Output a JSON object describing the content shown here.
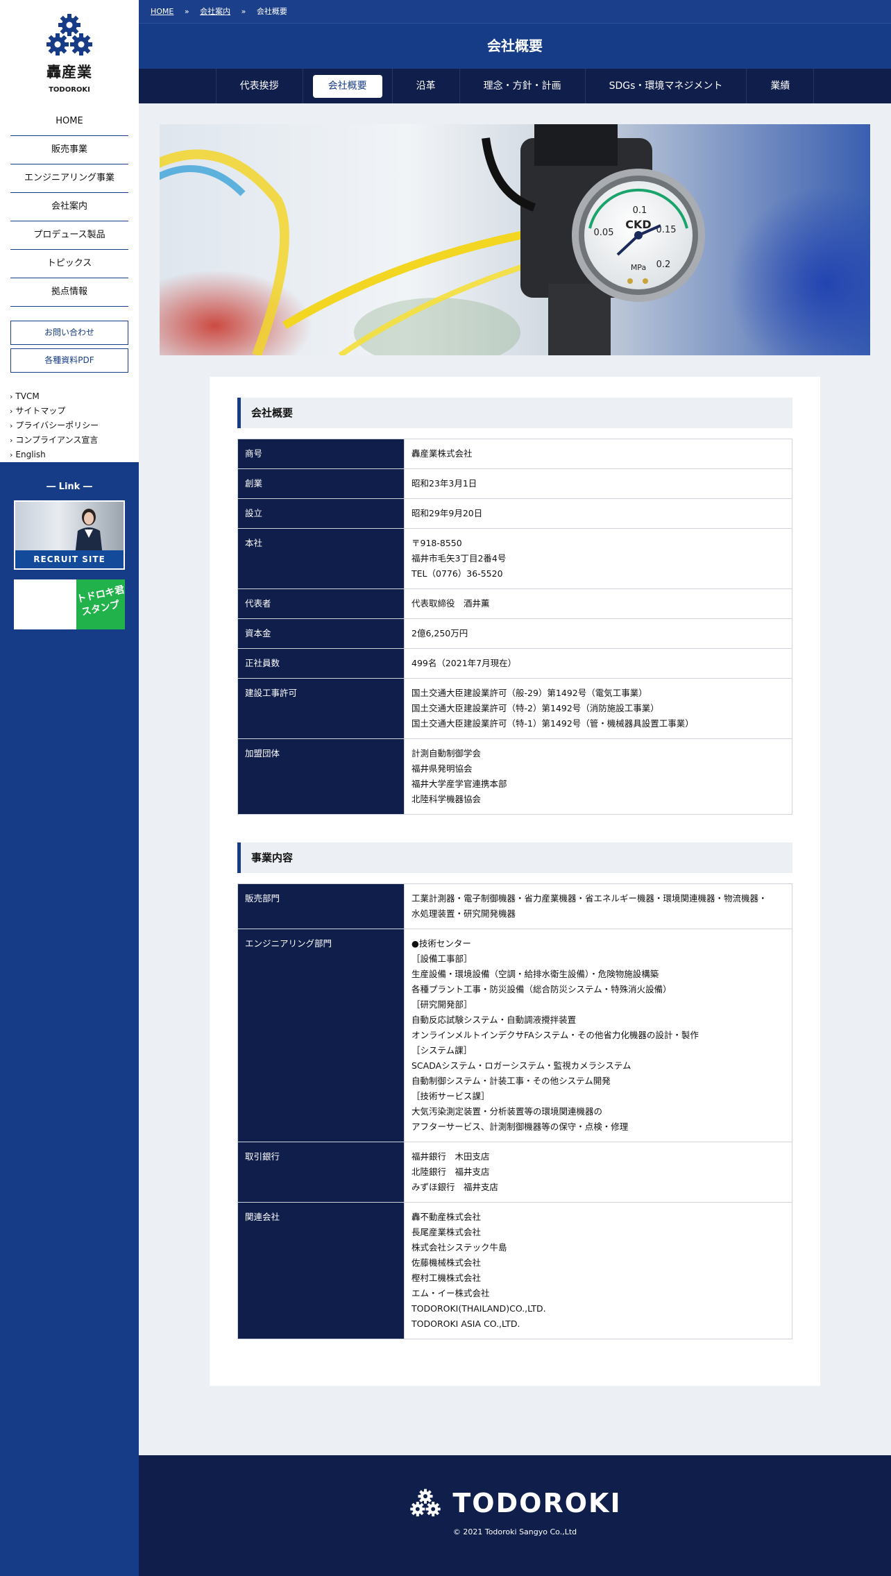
{
  "brand": {
    "name_jp": "轟産業",
    "name_en": "TODOROKI",
    "accent": "#163c87",
    "dark": "#101e4b"
  },
  "sidebar": {
    "nav": [
      {
        "label": "HOME"
      },
      {
        "label": "販売事業"
      },
      {
        "label": "エンジニアリング事業"
      },
      {
        "label": "会社案内"
      },
      {
        "label": "プロデュース製品"
      },
      {
        "label": "トピックス"
      },
      {
        "label": "拠点情報"
      }
    ],
    "buttons": [
      {
        "label": "お問い合わせ"
      },
      {
        "label": "各種資料PDF"
      }
    ],
    "sub_links": [
      {
        "label": "TVCM"
      },
      {
        "label": "サイトマップ"
      },
      {
        "label": "プライバシーポリシー"
      },
      {
        "label": "コンプライアンス宣言"
      },
      {
        "label": "English"
      }
    ],
    "link_title": "― Link ―",
    "recruit_label": "RECRUIT SITE",
    "stamp_line1": "トドロキ君",
    "stamp_line2": "スタンプ"
  },
  "breadcrumb": {
    "home": "HOME",
    "parent": "会社案内",
    "current": "会社概要",
    "sep": "»"
  },
  "page_title": "会社概要",
  "tabs": [
    {
      "label": "代表挨拶"
    },
    {
      "label": "会社概要"
    },
    {
      "label": "沿革"
    },
    {
      "label": "理念・方針・計画"
    },
    {
      "label": "SDGs・環境マネジメント"
    },
    {
      "label": "業績"
    }
  ],
  "hero": {
    "gauge_brand": "CKD",
    "gauge_unit": "MPa",
    "gauge_marks": [
      "0.05",
      "0.1",
      "0.15",
      "0.2"
    ]
  },
  "company": {
    "heading": "会社概要",
    "rows": [
      {
        "label": "商号",
        "lines": [
          "轟産業株式会社"
        ]
      },
      {
        "label": "創業",
        "lines": [
          "昭和23年3月1日"
        ]
      },
      {
        "label": "設立",
        "lines": [
          "昭和29年9月20日"
        ]
      },
      {
        "label": "本社",
        "lines": [
          "〒918-8550",
          "福井市毛矢3丁目2番4号",
          "TEL（0776）36-5520"
        ]
      },
      {
        "label": "代表者",
        "lines": [
          "代表取締役　酒井薫"
        ]
      },
      {
        "label": "資本金",
        "lines": [
          "2億6,250万円"
        ]
      },
      {
        "label": "正社員数",
        "lines": [
          "499名（2021年7月現在）"
        ]
      },
      {
        "label": "建設工事許可",
        "lines": [
          "国土交通大臣建設業許可（般-29）第1492号（電気工事業）",
          "国土交通大臣建設業許可（特-2）第1492号（消防施設工事業）",
          "国土交通大臣建設業許可（特-1）第1492号（管・機械器具設置工事業）"
        ]
      },
      {
        "label": "加盟団体",
        "lines": [
          "計測自動制御学会",
          "福井県発明協会",
          "福井大学産学官連携本部",
          "北陸科学機器協会"
        ]
      }
    ]
  },
  "business": {
    "heading": "事業内容",
    "rows": [
      {
        "label": "販売部門",
        "lines": [
          "工業計測器・電子制御機器・省力産業機器・省エネルギー機器・環境関連機器・物流機器・",
          "水処理装置・研究開発機器"
        ]
      },
      {
        "label": "エンジニアリング部門",
        "lines": [
          "●技術センター",
          "［設備工事部］",
          "生産設備・環境設備（空調・給排水衛生設備）・危険物施設構築",
          "各種プラント工事・防災設備（総合防災システム・特殊消火設備）",
          "［研究開発部］",
          "自動反応試験システム・自動調液攪拌装置",
          "オンラインメルトインデクサFAシステム・その他省力化機器の設計・製作",
          "［システム課］",
          "SCADAシステム・ロガーシステム・監視カメラシステム",
          "自動制御システム・計装工事・その他システム開発",
          "［技術サービス課］",
          "大気汚染測定装置・分析装置等の環境関連機器の",
          "アフターサービス、計測制御機器等の保守・点検・修理"
        ]
      },
      {
        "label": "取引銀行",
        "lines": [
          "福井銀行　木田支店",
          "北陸銀行　福井支店",
          "みずほ銀行　福井支店"
        ]
      },
      {
        "label": "関連会社",
        "lines": [
          "轟不動産株式会社",
          "長尾産業株式会社",
          "株式会社システック牛島",
          "佐藤機械株式会社",
          "樫村工機株式会社",
          "エム・イー株式会社",
          "TODOROKI(THAILAND)CO.,LTD.",
          "TODOROKI ASIA CO.,LTD."
        ]
      }
    ]
  },
  "footer": {
    "wordmark": "TODOROKI",
    "copyright": "© 2021 Todoroki Sangyo Co.,Ltd"
  }
}
